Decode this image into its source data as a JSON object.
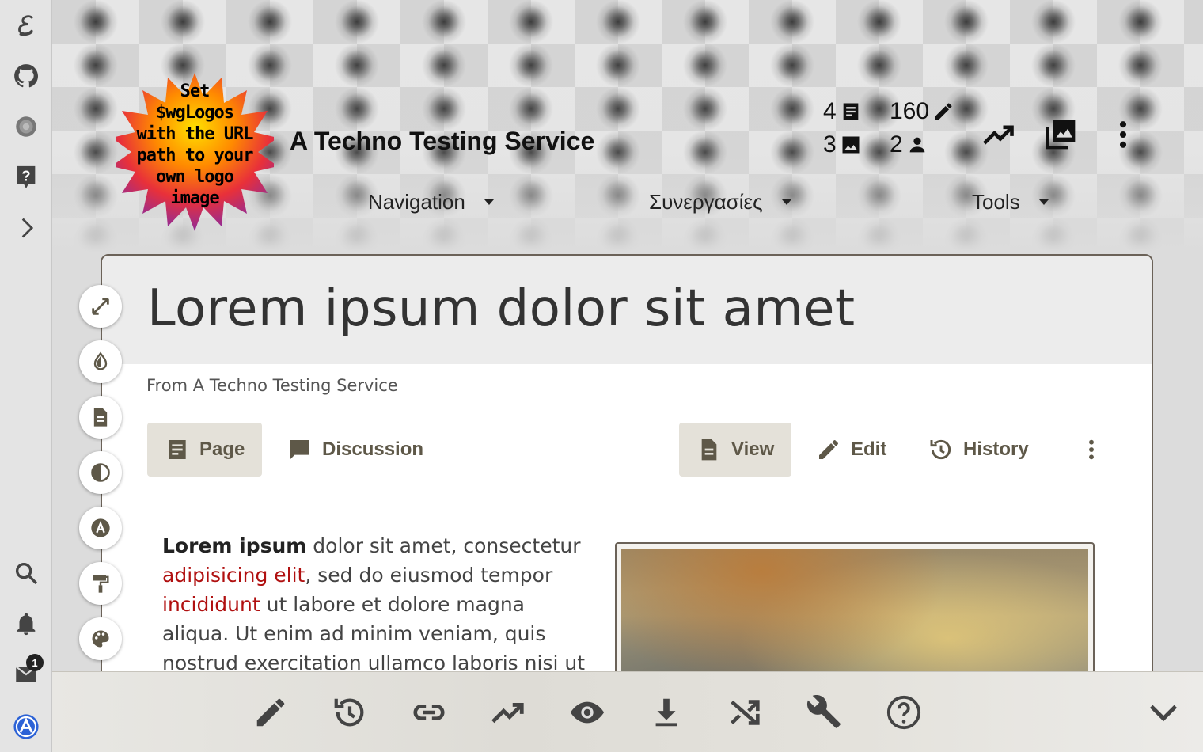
{
  "site": {
    "title": "A Techno Testing Service",
    "logo_text": [
      "Set",
      "$wgLogos",
      "with the URL",
      "path to your",
      "own logo",
      "image"
    ]
  },
  "rail": {
    "items": [
      {
        "icon": "script-e-icon"
      },
      {
        "icon": "github-icon"
      },
      {
        "icon": "gear-icon"
      },
      {
        "icon": "help-icon"
      },
      {
        "icon": "chevron-right-icon"
      },
      {
        "icon": "search-icon"
      },
      {
        "icon": "bell-icon"
      },
      {
        "icon": "mail-icon"
      },
      {
        "icon": "app-a-icon"
      }
    ],
    "mail_badge": "1"
  },
  "stats": {
    "articles": "4",
    "edits": "160",
    "images": "3",
    "users": "2"
  },
  "nav": {
    "navigation": "Navigation",
    "collaborations": "Συνεργασίες",
    "tools": "Tools"
  },
  "page": {
    "title": "Lorem ipsum dolor sit amet",
    "from": "From A Techno Testing Service",
    "tabs": {
      "page": "Page",
      "discussion": "Discussion",
      "view": "View",
      "edit": "Edit",
      "history": "History"
    },
    "content": {
      "bold": "Lorem ipsum",
      "t1": " dolor sit amet, consectetur ",
      "link1": "adipisicing elit",
      "t2": ", sed do eiusmod tempor ",
      "link2": "incididunt",
      "t3": " ut labore et dolore magna aliqua. Ut enim ad minim veniam, quis nostrud exercitation ullamco laboris nisi ut aliquip ex"
    }
  },
  "side_tools": [
    "expand-icon",
    "drop-icon",
    "document-icon",
    "contrast-icon",
    "font-icon",
    "paint-roller-icon",
    "palette-icon"
  ],
  "bottom_toolbar": [
    "edit-icon",
    "history-icon",
    "link-icon",
    "trending-icon",
    "watch-icon",
    "download-icon",
    "random-icon",
    "wrench-icon",
    "help-icon",
    "collapse-icon"
  ]
}
